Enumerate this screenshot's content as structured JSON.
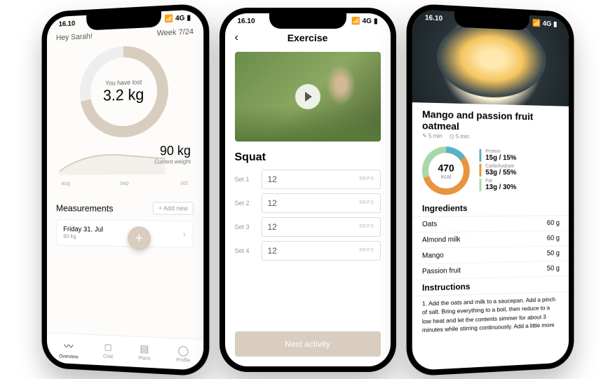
{
  "status": {
    "time": "16.10",
    "signal": "4G"
  },
  "p1": {
    "greeting": "Hey Sarah!",
    "week": "Week 7/24",
    "lost_label": "You have lost",
    "lost_value": "3.2 kg",
    "current_weight": "90 kg",
    "current_weight_label": "Current weight",
    "months": [
      "aug",
      "sep",
      "oct"
    ],
    "measurements_title": "Measurements",
    "add_new": "+ Add new",
    "meas_date": "Friday 31. Jul",
    "meas_weight": "90 kg",
    "tabs": [
      {
        "icon": "〰",
        "label": "Overview"
      },
      {
        "icon": "◻",
        "label": "Chat"
      },
      {
        "icon": "▤",
        "label": "Plans"
      },
      {
        "icon": "◯",
        "label": "Profile"
      }
    ]
  },
  "p2": {
    "title": "Exercise",
    "name": "Squat",
    "sets": [
      {
        "label": "Set 1",
        "reps": "12",
        "unit": "REPS"
      },
      {
        "label": "Set 2",
        "reps": "12",
        "unit": "REPS"
      },
      {
        "label": "Set 3",
        "reps": "12",
        "unit": "REPS"
      },
      {
        "label": "Set 4",
        "reps": "12",
        "unit": "REPS"
      }
    ],
    "next": "Next activity"
  },
  "p3": {
    "title": "Mango and passion fruit oatmeal",
    "prep": "5 min",
    "cook": "5 min",
    "calories": "470",
    "cal_unit": "kcal",
    "macros": {
      "protein": {
        "label": "Protein",
        "value": "15g / 15%"
      },
      "carb": {
        "label": "Carbohydrate",
        "value": "53g / 55%"
      },
      "fat": {
        "label": "Fat",
        "value": "13g / 30%"
      }
    },
    "ingredients_title": "Ingredients",
    "ingredients": [
      {
        "name": "Oats",
        "amount": "60 g"
      },
      {
        "name": "Almond milk",
        "amount": "60 g"
      },
      {
        "name": "Mango",
        "amount": "50 g"
      },
      {
        "name": "Passion fruit",
        "amount": "50 g"
      }
    ],
    "instructions_title": "Instructions",
    "instruction_1": "1. Add the oats and milk to a saucepan. Add a pinch of salt. Bring everything to a boil, then reduce to a low heat and let the contents simmer for about 3 minutes while stirring continuously. Add a little more"
  }
}
